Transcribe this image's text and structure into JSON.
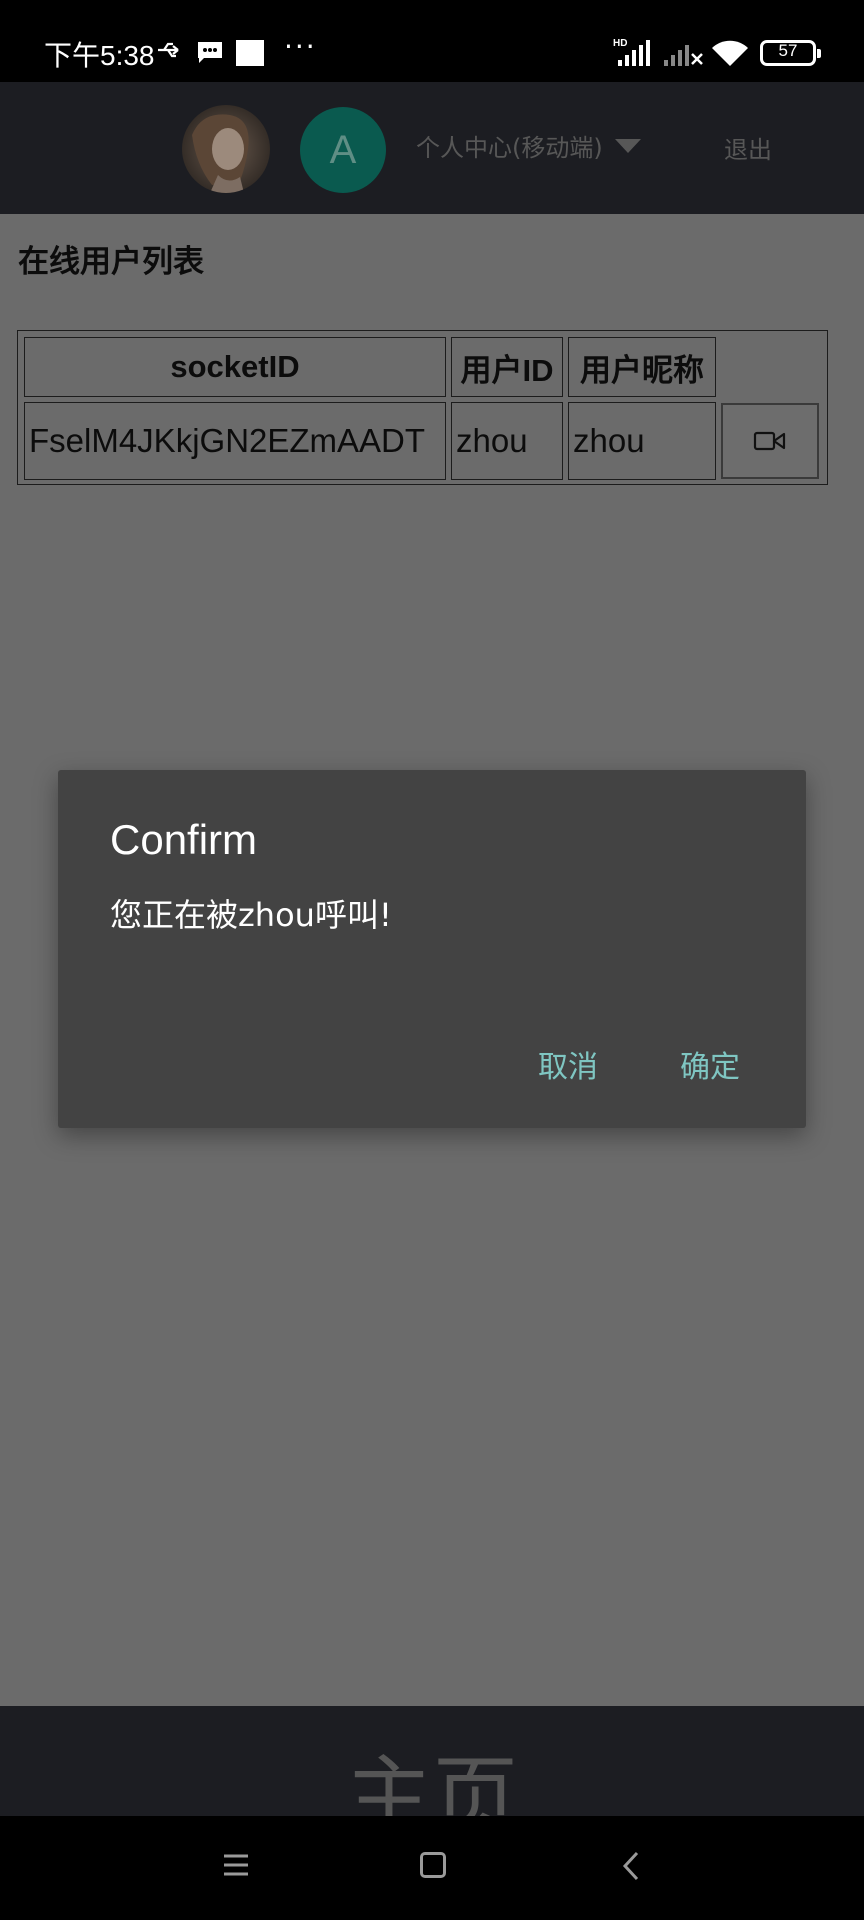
{
  "status_bar": {
    "time": "下午5:38",
    "dots": "···",
    "battery": "57",
    "icons": [
      "usb-icon",
      "message-icon",
      "square-icon",
      "hd-signal-icon",
      "signal-icon",
      "wifi-icon",
      "battery-icon"
    ]
  },
  "header": {
    "avatar_letter": "A",
    "user_center_label": "个人中心(移动端)",
    "logout_label": "退出"
  },
  "main": {
    "title": "在线用户列表",
    "table": {
      "headers": [
        "socketID",
        "用户ID",
        "用户昵称",
        ""
      ],
      "rows": [
        [
          "FselM4JKkjGN2EZmAADT",
          "zhou",
          "zhou"
        ]
      ]
    }
  },
  "dialog": {
    "title": "Confirm",
    "message": "您正在被zhou呼叫!",
    "cancel_label": "取消",
    "ok_label": "确定"
  },
  "footer": {
    "label": "主页"
  },
  "colors": {
    "overlay_bg": "#6b6b6b",
    "header_bg": "#1c1d22",
    "dialog_bg": "#434343",
    "dialog_button": "#7fc6c2",
    "avatar_teal": "#0a5a4f"
  }
}
